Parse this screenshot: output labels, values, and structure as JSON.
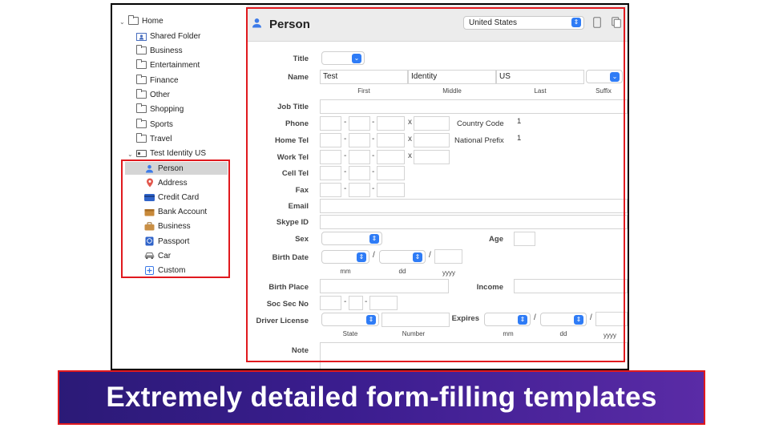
{
  "sidebar": {
    "home": "Home",
    "folders": [
      "Shared Folder",
      "Business",
      "Entertainment",
      "Finance",
      "Other",
      "Shopping",
      "Sports",
      "Travel"
    ],
    "identity": "Test Identity US",
    "sections": [
      "Person",
      "Address",
      "Credit Card",
      "Bank Account",
      "Business",
      "Passport",
      "Car",
      "Custom"
    ]
  },
  "header": {
    "title": "Person",
    "country": "United States"
  },
  "form": {
    "title_label": "Title",
    "name_label": "Name",
    "name_first": "Test",
    "name_middle": "Identity",
    "name_last": "US",
    "first_sub": "First",
    "middle_sub": "Middle",
    "last_sub": "Last",
    "suffix_sub": "Suffix",
    "job_title": "Job Title",
    "phone": "Phone",
    "home_tel": "Home Tel",
    "work_tel": "Work Tel",
    "cell_tel": "Cell Tel",
    "fax": "Fax",
    "email": "Email",
    "skype": "Skype ID",
    "sex": "Sex",
    "age": "Age",
    "birth_date": "Birth Date",
    "birth_place": "Birth Place",
    "income": "Income",
    "soc_sec": "Soc Sec No",
    "driver_license": "Driver License",
    "expires": "Expires",
    "note": "Note",
    "country_code_label": "Country Code",
    "country_code_value": "1",
    "national_prefix_label": "National Prefix",
    "national_prefix_value": "1",
    "x": "x",
    "dash": "-",
    "slash": "/",
    "mm": "mm",
    "dd": "dd",
    "yyyy": "yyyy",
    "state": "State",
    "number": "Number"
  },
  "banner": {
    "text": "Extremely detailed form-filling templates"
  },
  "colors": {
    "highlight": "#e0191e",
    "accent": "#2f7cf6",
    "banner_start": "#2b1a77",
    "banner_end": "#5a2ba6"
  }
}
